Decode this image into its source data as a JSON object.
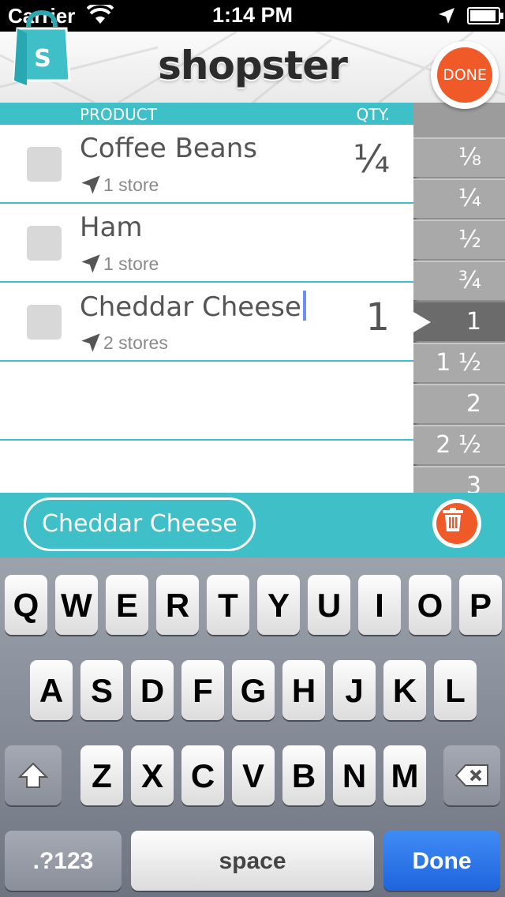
{
  "status_bar": {
    "carrier": "Carrier",
    "time": "1:14 PM"
  },
  "header": {
    "title": "shopster",
    "done_label": "DONE",
    "logo_letter": "S"
  },
  "columns": {
    "product": "PRODUCT",
    "qty": "QTY."
  },
  "items": [
    {
      "name": "Coffee Beans",
      "stores": "1 store",
      "qty": "¼",
      "show_qty": true
    },
    {
      "name": "Ham",
      "stores": "1 store",
      "qty": "",
      "show_qty": false
    },
    {
      "name": "Cheddar Cheese",
      "stores": "2 stores",
      "qty": "1",
      "show_qty": true,
      "editing": true
    }
  ],
  "qty_options": [
    "⅛",
    "¼",
    "½",
    "¾",
    "1",
    "1 ½",
    "2",
    "2 ½",
    "3"
  ],
  "qty_selected": "1",
  "edit_bar": {
    "item_name": "Cheddar Cheese"
  },
  "keyboard": {
    "row1": [
      "Q",
      "W",
      "E",
      "R",
      "T",
      "Y",
      "U",
      "I",
      "O",
      "P"
    ],
    "row2": [
      "A",
      "S",
      "D",
      "F",
      "G",
      "H",
      "J",
      "K",
      "L"
    ],
    "row3": [
      "Z",
      "X",
      "C",
      "V",
      "B",
      "N",
      "M"
    ],
    "numbers_label": ".?123",
    "space_label": "space",
    "done_label": "Done"
  },
  "colors": {
    "teal": "#3fbfc8",
    "orange": "#f05a28",
    "keyboard_done": "#2a74e8"
  }
}
